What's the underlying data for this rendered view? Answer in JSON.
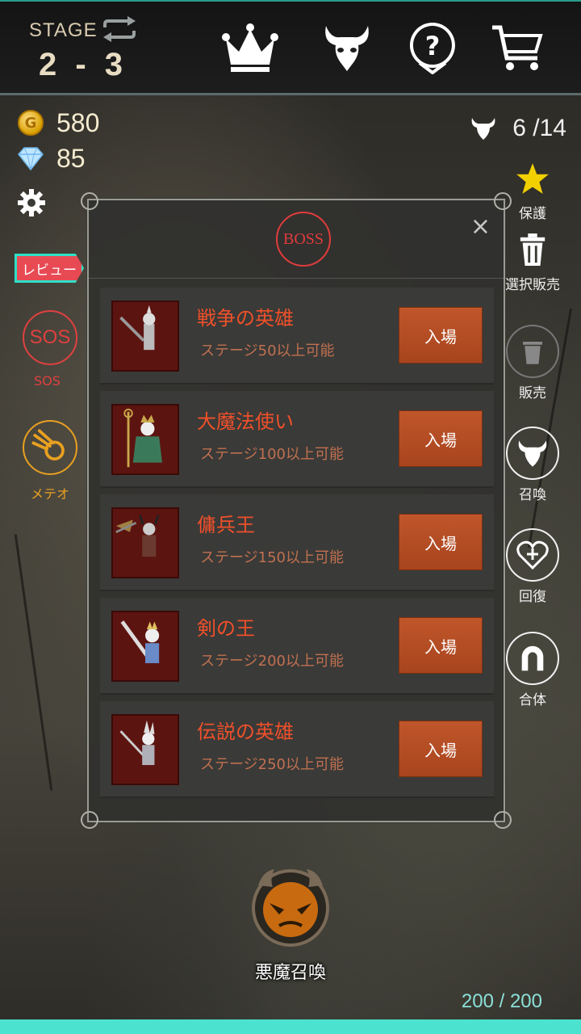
{
  "header": {
    "stage_label": "STAGE",
    "stage_value": "2 - 3",
    "icons": [
      "repeat-icon",
      "crown-icon",
      "devil-icon",
      "help-icon",
      "cart-icon"
    ]
  },
  "currency": {
    "coins": "580",
    "gems": "85"
  },
  "summon_count": "6 /14",
  "review_label": "レビュー",
  "left_buttons": {
    "sos_label": "SOS",
    "sos_caption": "SOS",
    "meteor_caption": "メテオ"
  },
  "right_buttons": {
    "protect": "保護",
    "select_sell": "選択販売",
    "sell": "販売",
    "summon": "召喚",
    "recover": "回復",
    "merge": "合体"
  },
  "modal": {
    "badge": "BOSS",
    "close": "×",
    "bosses": [
      {
        "name": "戦争の英雄",
        "requirement": "ステージ50以上可能",
        "button": "入場"
      },
      {
        "name": "大魔法使い",
        "requirement": "ステージ100以上可能",
        "button": "入場"
      },
      {
        "name": "傭兵王",
        "requirement": "ステージ150以上可能",
        "button": "入場"
      },
      {
        "name": "剣の王",
        "requirement": "ステージ200以上可能",
        "button": "入場"
      },
      {
        "name": "伝説の英雄",
        "requirement": "ステージ250以上可能",
        "button": "入場"
      }
    ]
  },
  "summon_button_label": "悪魔召喚",
  "hp": {
    "text": "200 / 200",
    "fraction": 1.0
  },
  "colors": {
    "accent_teal": "#4be3cf",
    "boss_red": "#e03c3c",
    "name_orange": "#f0502a",
    "enter_button": "#b04a20"
  }
}
